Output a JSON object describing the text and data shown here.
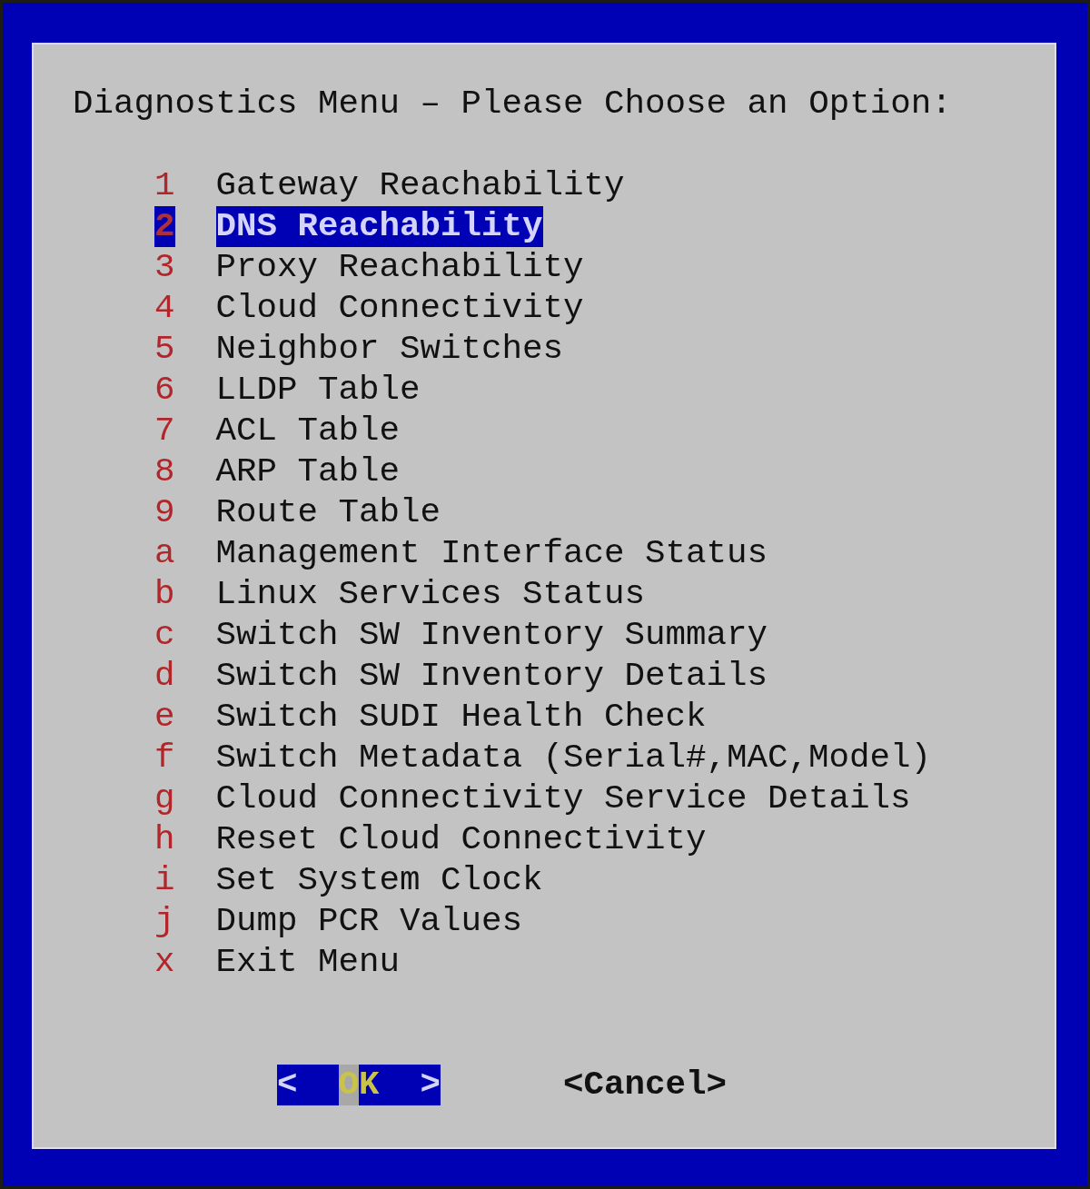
{
  "window": {
    "title": "Diagnostics Menu – Please Choose an Option:"
  },
  "menu": {
    "items": [
      {
        "key": "1",
        "label": "Gateway Reachability",
        "selected": false
      },
      {
        "key": "2",
        "label": "DNS Reachability",
        "selected": true
      },
      {
        "key": "3",
        "label": "Proxy Reachability",
        "selected": false
      },
      {
        "key": "4",
        "label": "Cloud Connectivity",
        "selected": false
      },
      {
        "key": "5",
        "label": "Neighbor Switches",
        "selected": false
      },
      {
        "key": "6",
        "label": "LLDP Table",
        "selected": false
      },
      {
        "key": "7",
        "label": "ACL Table",
        "selected": false
      },
      {
        "key": "8",
        "label": "ARP Table",
        "selected": false
      },
      {
        "key": "9",
        "label": "Route Table",
        "selected": false
      },
      {
        "key": "a",
        "label": "Management Interface Status",
        "selected": false
      },
      {
        "key": "b",
        "label": "Linux Services Status",
        "selected": false
      },
      {
        "key": "c",
        "label": "Switch SW Inventory Summary",
        "selected": false
      },
      {
        "key": "d",
        "label": "Switch SW Inventory Details",
        "selected": false
      },
      {
        "key": "e",
        "label": "Switch SUDI Health Check",
        "selected": false
      },
      {
        "key": "f",
        "label": "Switch Metadata (Serial#,MAC,Model)",
        "selected": false
      },
      {
        "key": "g",
        "label": "Cloud Connectivity Service Details",
        "selected": false
      },
      {
        "key": "h",
        "label": "Reset Cloud Connectivity",
        "selected": false
      },
      {
        "key": "i",
        "label": "Set System Clock",
        "selected": false
      },
      {
        "key": "j",
        "label": "Dump PCR Values",
        "selected": false
      },
      {
        "key": "x",
        "label": "Exit Menu",
        "selected": false
      }
    ]
  },
  "buttons": [
    {
      "left": "<",
      "label": "OK",
      "right": ">",
      "selected": true
    },
    {
      "left": "<",
      "label": "Cancel",
      "right": ">",
      "selected": false
    }
  ]
}
